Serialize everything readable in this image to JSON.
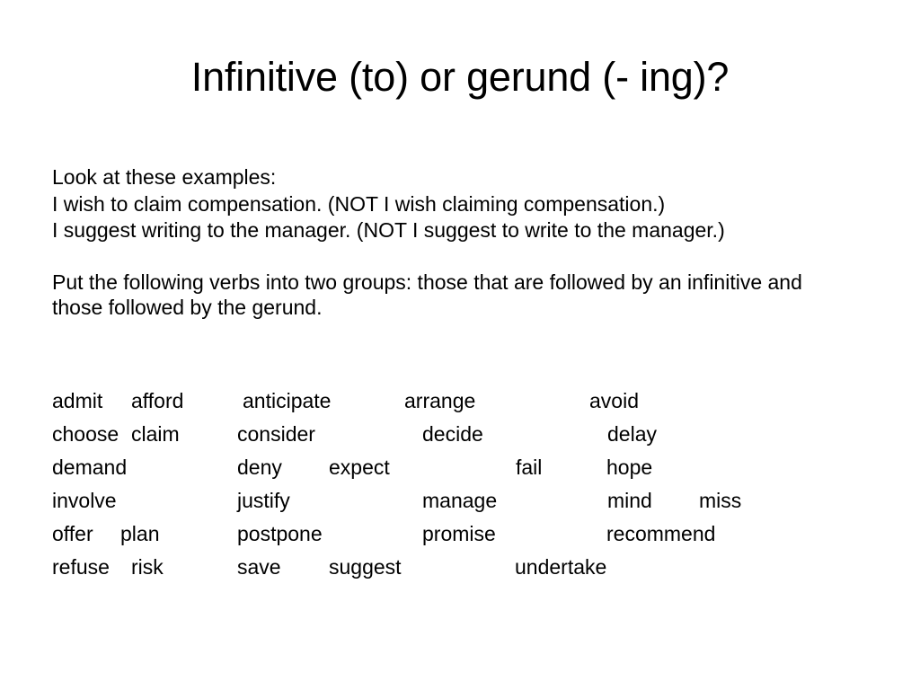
{
  "slide": {
    "background_color": "#ffffff",
    "text_color": "#000000",
    "title": "Infinitive (to) or gerund (- ing)?"
  },
  "body": {
    "intro": "Look at these examples:",
    "example_1": "I wish to claim compensation. (NOT I wish claiming compensation.)",
    "example_2": "I suggest writing to the manager. (NOT I suggest to write to the manager.)",
    "instruction": "Put the following verbs into two groups: those that are followed by an infinitive and those followed by the gerund."
  },
  "verb_rows": [
    [
      "admit",
      "afford",
      "anticipate",
      "arrange",
      "avoid"
    ],
    [
      "choose",
      "claim",
      "consider",
      "decide",
      "delay"
    ],
    [
      "demand",
      "deny",
      "expect",
      "fail",
      "hope"
    ],
    [
      "involve",
      "justify",
      "manage",
      "mind",
      "miss"
    ],
    [
      "offer",
      "plan",
      "postpone",
      "promise",
      "recommend"
    ],
    [
      "refuse",
      "risk",
      "save",
      "suggest",
      "undertake"
    ]
  ]
}
